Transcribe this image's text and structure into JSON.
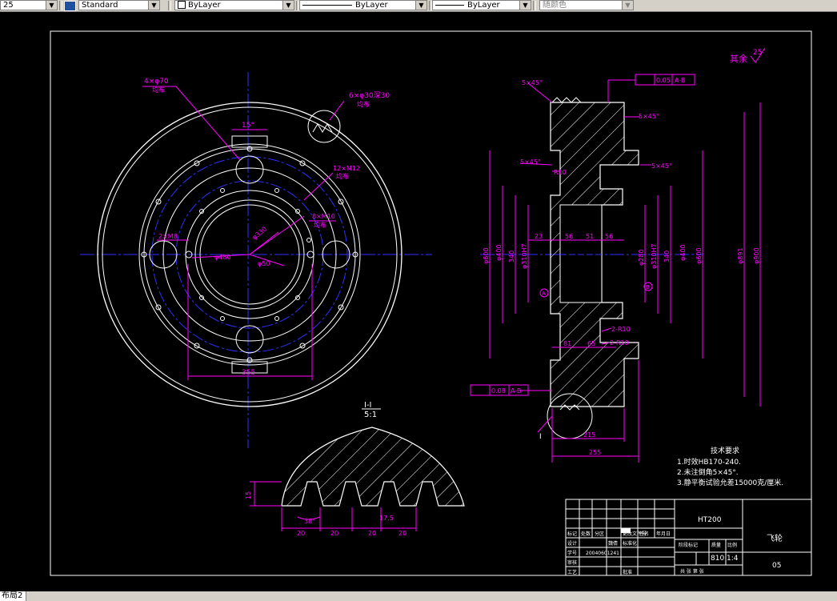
{
  "toolbar": {
    "scale_value": "25",
    "text_style": "Standard",
    "layer": "ByLayer",
    "linetype": "ByLayer",
    "lineweight": "ByLayer",
    "plot_style": "随颜色"
  },
  "status": {
    "layout_tab": "布局2"
  },
  "drawing": {
    "roughness_other": "其余",
    "roughness_other_value": "25",
    "front_view": {
      "holes_label": "4×φ70",
      "holes_sub": "均布",
      "lightening_label": "6×φ30深30",
      "lightening_sub": "均布",
      "thread1_label": "12×M12",
      "thread1_sub": "均布",
      "thread2_label": "8×M10",
      "thread2_sub": "均布",
      "thread3_label": "2×M8",
      "angle_label": "15°",
      "dim_355": "355",
      "dim_r480": "φ480",
      "dim_r330": "φ330",
      "dim_r50": "φ50",
      "section_mark": "I"
    },
    "section_view": {
      "chamfer_1": "5×45°",
      "chamfer_2": "5×45°",
      "chamfer_3": "5×45°",
      "chamfer_4": "5×45°",
      "tol_top": "0.05",
      "datum_top": "A-B",
      "tol_bottom": "0.08",
      "datum_bottom": "A-B",
      "r10a": "R10",
      "r10b": "2-R10",
      "r10c": "2-R10",
      "d_600": "φ600",
      "d_400": "φ400",
      "d_340": "340",
      "d_310": "φ310H7",
      "d_280": "φ280",
      "d_340b": "340",
      "d_310b": "φ310H7",
      "d_400b": "φ400",
      "d_600b": "φ600",
      "d_891": "φ891",
      "d_900": "φ900",
      "w_23": "23",
      "w_56": "56",
      "w_51": "51",
      "w_56b": "56",
      "w_81": "81",
      "w_65": "65",
      "w_215": "215",
      "w_255": "255",
      "datum_a": "A",
      "datum_b": "B",
      "detail_mark": "I"
    },
    "detail": {
      "title": "I-I",
      "scale": "5:1",
      "h_15": "15",
      "angle_38": "38°",
      "w_20a": "20",
      "w_20b": "20",
      "w_17": "17.5",
      "w_20c": "20",
      "w_20d": "20"
    },
    "notes": {
      "title": "技术要求",
      "line1": "1.时效HB170-240.",
      "line2": "2.未注倒角5×45°.",
      "line3": "3.静平衡试验允差15000克/厘米."
    },
    "title_block": {
      "material": "HT200",
      "part_name": "飞轮",
      "drawing_no": "05",
      "weight": "810",
      "scale": "1:4",
      "designer_label": "设计",
      "reviewer_label": "审核",
      "process_label": "工艺",
      "student_label": "学号",
      "student_no": "20040601241",
      "sign_label": "标记",
      "count_label": "处数",
      "zone_label": "分区",
      "doc_label": "更改文件号",
      "signature_label": "签名",
      "date_label": "年月日",
      "std_label": "标准化",
      "approve_label": "批准",
      "stage_label": "阶段标记",
      "weight_label": "质量",
      "scale_label": "比例",
      "sheets_label": "共 张 第 张",
      "designer_name": "魏倩"
    }
  }
}
